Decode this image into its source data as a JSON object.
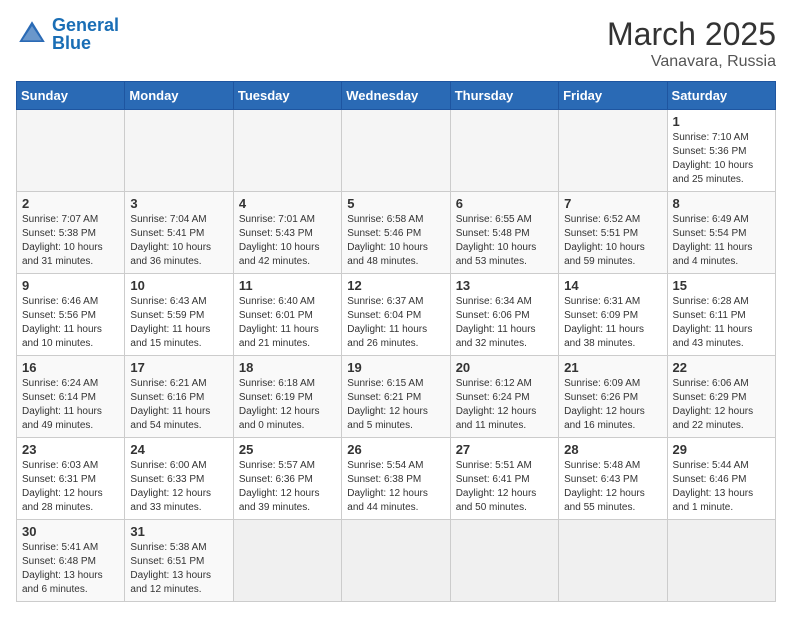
{
  "header": {
    "logo_general": "General",
    "logo_blue": "Blue",
    "month_year": "March 2025",
    "location": "Vanavara, Russia"
  },
  "days_of_week": [
    "Sunday",
    "Monday",
    "Tuesday",
    "Wednesday",
    "Thursday",
    "Friday",
    "Saturday"
  ],
  "weeks": [
    [
      {
        "day": "",
        "info": ""
      },
      {
        "day": "",
        "info": ""
      },
      {
        "day": "",
        "info": ""
      },
      {
        "day": "",
        "info": ""
      },
      {
        "day": "",
        "info": ""
      },
      {
        "day": "",
        "info": ""
      },
      {
        "day": "1",
        "info": "Sunrise: 7:10 AM\nSunset: 5:36 PM\nDaylight: 10 hours and 25 minutes."
      }
    ],
    [
      {
        "day": "2",
        "info": "Sunrise: 7:07 AM\nSunset: 5:38 PM\nDaylight: 10 hours and 31 minutes."
      },
      {
        "day": "3",
        "info": "Sunrise: 7:04 AM\nSunset: 5:41 PM\nDaylight: 10 hours and 36 minutes."
      },
      {
        "day": "4",
        "info": "Sunrise: 7:01 AM\nSunset: 5:43 PM\nDaylight: 10 hours and 42 minutes."
      },
      {
        "day": "5",
        "info": "Sunrise: 6:58 AM\nSunset: 5:46 PM\nDaylight: 10 hours and 48 minutes."
      },
      {
        "day": "6",
        "info": "Sunrise: 6:55 AM\nSunset: 5:48 PM\nDaylight: 10 hours and 53 minutes."
      },
      {
        "day": "7",
        "info": "Sunrise: 6:52 AM\nSunset: 5:51 PM\nDaylight: 10 hours and 59 minutes."
      },
      {
        "day": "8",
        "info": "Sunrise: 6:49 AM\nSunset: 5:54 PM\nDaylight: 11 hours and 4 minutes."
      }
    ],
    [
      {
        "day": "9",
        "info": "Sunrise: 6:46 AM\nSunset: 5:56 PM\nDaylight: 11 hours and 10 minutes."
      },
      {
        "day": "10",
        "info": "Sunrise: 6:43 AM\nSunset: 5:59 PM\nDaylight: 11 hours and 15 minutes."
      },
      {
        "day": "11",
        "info": "Sunrise: 6:40 AM\nSunset: 6:01 PM\nDaylight: 11 hours and 21 minutes."
      },
      {
        "day": "12",
        "info": "Sunrise: 6:37 AM\nSunset: 6:04 PM\nDaylight: 11 hours and 26 minutes."
      },
      {
        "day": "13",
        "info": "Sunrise: 6:34 AM\nSunset: 6:06 PM\nDaylight: 11 hours and 32 minutes."
      },
      {
        "day": "14",
        "info": "Sunrise: 6:31 AM\nSunset: 6:09 PM\nDaylight: 11 hours and 38 minutes."
      },
      {
        "day": "15",
        "info": "Sunrise: 6:28 AM\nSunset: 6:11 PM\nDaylight: 11 hours and 43 minutes."
      }
    ],
    [
      {
        "day": "16",
        "info": "Sunrise: 6:24 AM\nSunset: 6:14 PM\nDaylight: 11 hours and 49 minutes."
      },
      {
        "day": "17",
        "info": "Sunrise: 6:21 AM\nSunset: 6:16 PM\nDaylight: 11 hours and 54 minutes."
      },
      {
        "day": "18",
        "info": "Sunrise: 6:18 AM\nSunset: 6:19 PM\nDaylight: 12 hours and 0 minutes."
      },
      {
        "day": "19",
        "info": "Sunrise: 6:15 AM\nSunset: 6:21 PM\nDaylight: 12 hours and 5 minutes."
      },
      {
        "day": "20",
        "info": "Sunrise: 6:12 AM\nSunset: 6:24 PM\nDaylight: 12 hours and 11 minutes."
      },
      {
        "day": "21",
        "info": "Sunrise: 6:09 AM\nSunset: 6:26 PM\nDaylight: 12 hours and 16 minutes."
      },
      {
        "day": "22",
        "info": "Sunrise: 6:06 AM\nSunset: 6:29 PM\nDaylight: 12 hours and 22 minutes."
      }
    ],
    [
      {
        "day": "23",
        "info": "Sunrise: 6:03 AM\nSunset: 6:31 PM\nDaylight: 12 hours and 28 minutes."
      },
      {
        "day": "24",
        "info": "Sunrise: 6:00 AM\nSunset: 6:33 PM\nDaylight: 12 hours and 33 minutes."
      },
      {
        "day": "25",
        "info": "Sunrise: 5:57 AM\nSunset: 6:36 PM\nDaylight: 12 hours and 39 minutes."
      },
      {
        "day": "26",
        "info": "Sunrise: 5:54 AM\nSunset: 6:38 PM\nDaylight: 12 hours and 44 minutes."
      },
      {
        "day": "27",
        "info": "Sunrise: 5:51 AM\nSunset: 6:41 PM\nDaylight: 12 hours and 50 minutes."
      },
      {
        "day": "28",
        "info": "Sunrise: 5:48 AM\nSunset: 6:43 PM\nDaylight: 12 hours and 55 minutes."
      },
      {
        "day": "29",
        "info": "Sunrise: 5:44 AM\nSunset: 6:46 PM\nDaylight: 13 hours and 1 minute."
      }
    ],
    [
      {
        "day": "30",
        "info": "Sunrise: 5:41 AM\nSunset: 6:48 PM\nDaylight: 13 hours and 6 minutes."
      },
      {
        "day": "31",
        "info": "Sunrise: 5:38 AM\nSunset: 6:51 PM\nDaylight: 13 hours and 12 minutes."
      },
      {
        "day": "",
        "info": ""
      },
      {
        "day": "",
        "info": ""
      },
      {
        "day": "",
        "info": ""
      },
      {
        "day": "",
        "info": ""
      },
      {
        "day": "",
        "info": ""
      }
    ]
  ]
}
